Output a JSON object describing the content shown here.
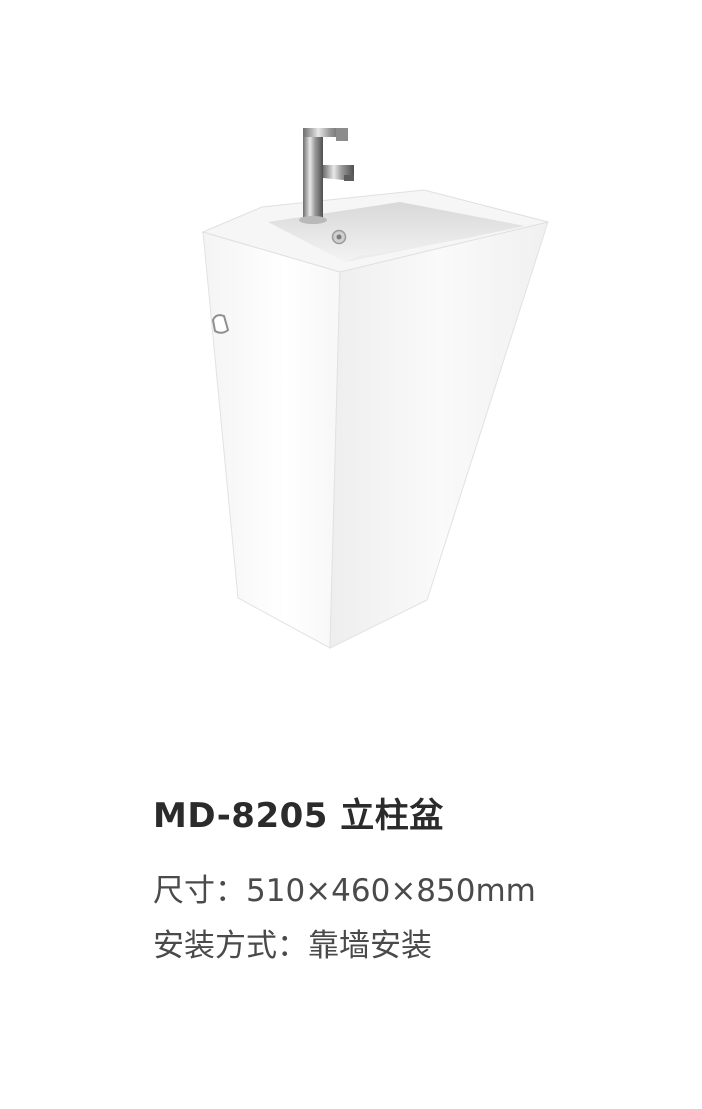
{
  "product": {
    "image": {
      "name": "pedestal-basin-with-faucet"
    },
    "title": "MD-8205 立柱盆",
    "specs": {
      "size": "尺寸：510×460×850mm",
      "install": "安装方式：靠墙安装"
    }
  }
}
